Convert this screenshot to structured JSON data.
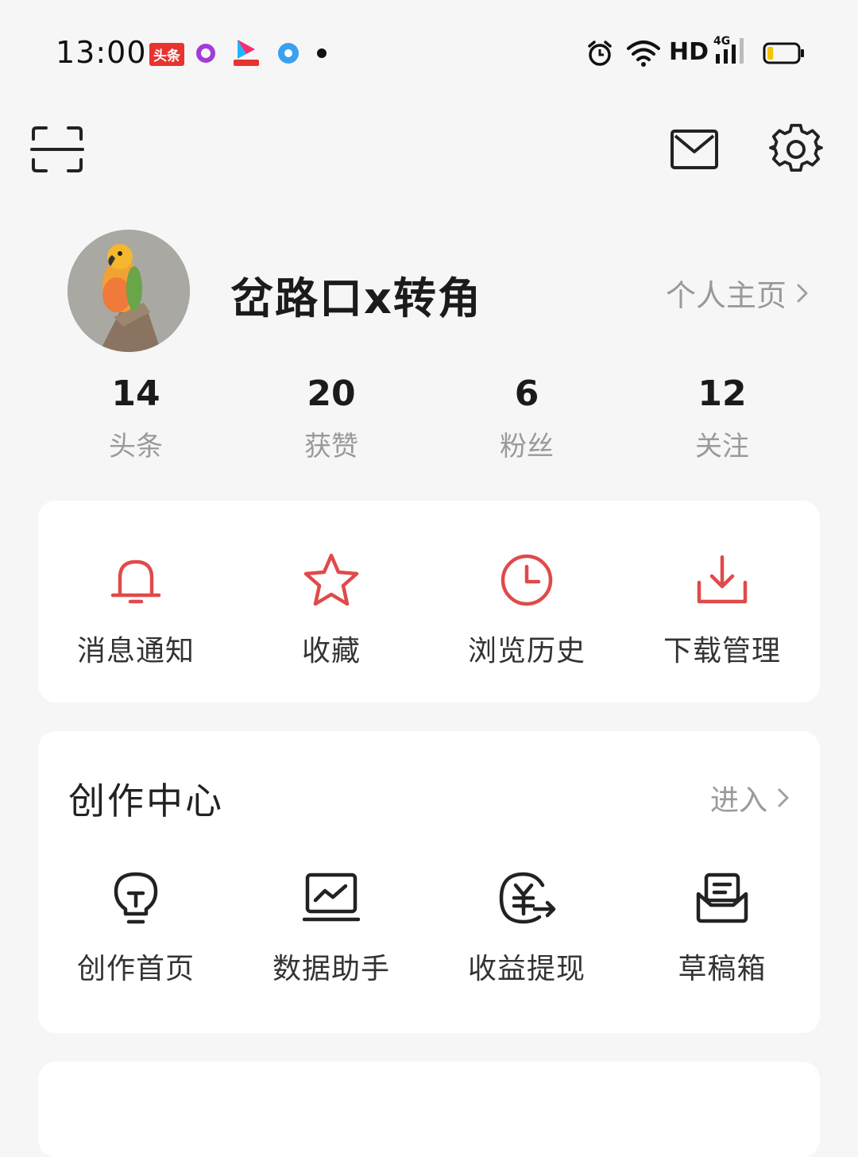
{
  "status_bar": {
    "time": "13:00",
    "toutiao_badge": "头条",
    "network_label": "HD",
    "signal_label": "4G",
    "icons": [
      "toutiao-app-icon",
      "purple-ring-app-icon",
      "video-app-icon",
      "blue-circle-app-icon",
      "alarm-icon",
      "wifi-icon",
      "signal-icon",
      "battery-icon"
    ],
    "battery_level": 0.2
  },
  "toolbar": {
    "icons": [
      "scan-icon",
      "mail-icon",
      "settings-icon"
    ]
  },
  "profile": {
    "username": "岔路口x转角",
    "homepage_label": "个人主页"
  },
  "stats": [
    {
      "value": "14",
      "label": "头条"
    },
    {
      "value": "20",
      "label": "获赞"
    },
    {
      "value": "6",
      "label": "粉丝"
    },
    {
      "value": "12",
      "label": "关注"
    }
  ],
  "quick_actions": [
    {
      "label": "消息通知",
      "icon": "bell-icon"
    },
    {
      "label": "收藏",
      "icon": "star-icon"
    },
    {
      "label": "浏览历史",
      "icon": "clock-icon"
    },
    {
      "label": "下载管理",
      "icon": "download-icon"
    }
  ],
  "creation_center": {
    "title": "创作中心",
    "enter_label": "进入",
    "items": [
      {
        "label": "创作首页",
        "icon": "lightbulb-icon"
      },
      {
        "label": "数据助手",
        "icon": "chart-monitor-icon"
      },
      {
        "label": "收益提现",
        "icon": "yuan-withdraw-icon"
      },
      {
        "label": "草稿箱",
        "icon": "draft-box-icon"
      }
    ]
  },
  "colors": {
    "accent": "#e04a4a",
    "background": "#f6f6f6",
    "card": "#ffffff",
    "muted_text": "#9a9a9a"
  }
}
